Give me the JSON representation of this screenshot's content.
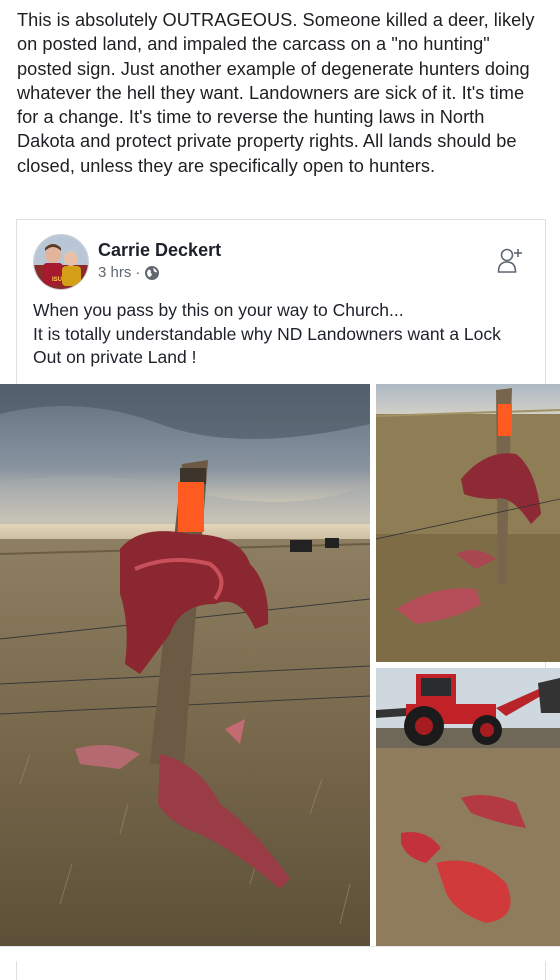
{
  "post": {
    "text": "This is absolutely OUTRAGEOUS. Someone killed a deer, likely on posted land, and impaled the carcass on a \"no hunting\" posted sign. Just another example of degenerate hunters doing whatever the hell they want. Landowners are sick of it. It's time for a change. It's time to reverse the hunting laws in North Dakota and protect private property rights. All lands should be closed, unless they are specifically open to hunters."
  },
  "shared_post": {
    "author": "Carrie Deckert",
    "time": "3 hrs",
    "separator": "·",
    "privacy_icon": "globe-icon",
    "action_icon": "add-friend-icon",
    "text_line1": "When you pass by this on your way to Church...",
    "text_line2": "It is totally understandable why ND Landowners want a Lock Out on private Land !"
  },
  "photos": [
    {
      "name": "deer-carcass-on-post-photo"
    },
    {
      "name": "carcass-on-post-closeup-photo"
    },
    {
      "name": "red-tractor-field-photo"
    }
  ],
  "colors": {
    "name": "#1d2129",
    "meta": "#606770",
    "border": "#dddfe2",
    "post_orange": "#ff5a1f"
  }
}
